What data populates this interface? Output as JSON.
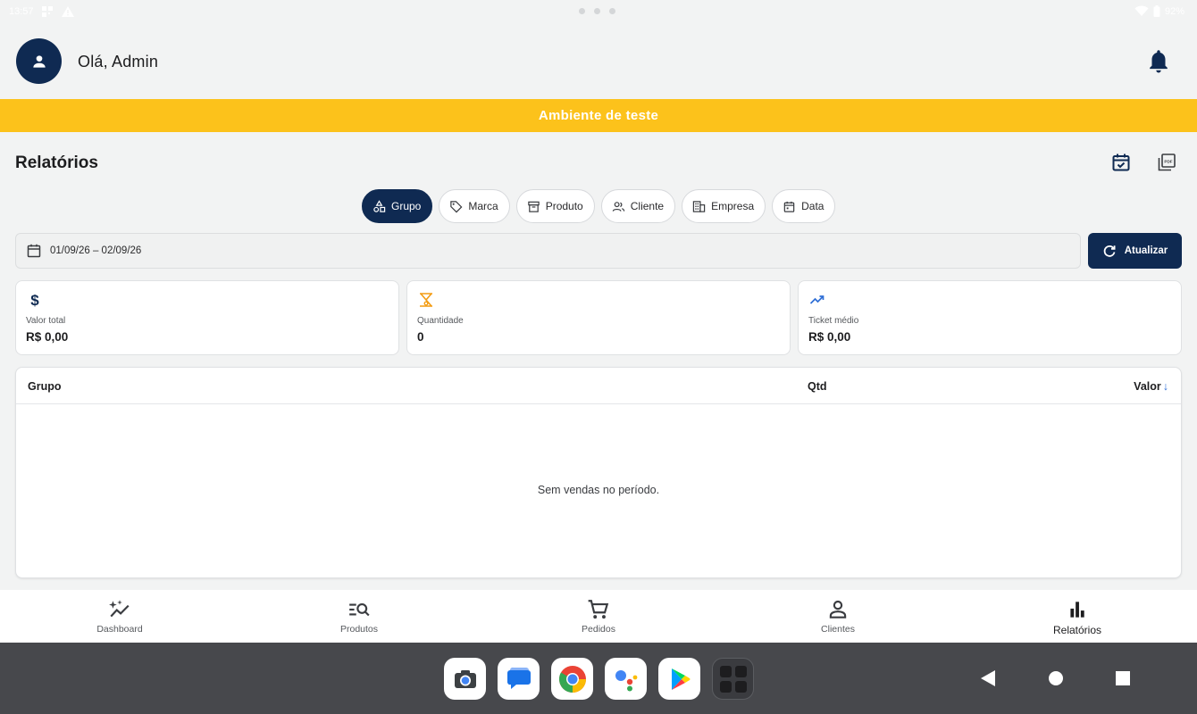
{
  "status_bar": {
    "time": "13:57",
    "battery": "92%"
  },
  "header": {
    "greeting": "Olá, Admin"
  },
  "banner": {
    "text": "Ambiente de teste"
  },
  "page": {
    "title": "Relatórios"
  },
  "filters": [
    {
      "label": "Grupo",
      "icon": "shapes-icon",
      "active": true
    },
    {
      "label": "Marca",
      "icon": "tag-icon",
      "active": false
    },
    {
      "label": "Produto",
      "icon": "box-icon",
      "active": false
    },
    {
      "label": "Cliente",
      "icon": "people-icon",
      "active": false
    },
    {
      "label": "Empresa",
      "icon": "building-icon",
      "active": false
    },
    {
      "label": "Data",
      "icon": "calendar-icon",
      "active": false
    }
  ],
  "date_range": {
    "value": "01/09/26 – 02/09/26"
  },
  "refresh_button": {
    "label": "Atualizar"
  },
  "stats": [
    {
      "label": "Valor total",
      "value": "R$ 0,00",
      "icon": "dollar-icon",
      "color": "#0f2a52"
    },
    {
      "label": "Quantidade",
      "value": "0",
      "icon": "quantity-icon",
      "color": "#f39c12"
    },
    {
      "label": "Ticket médio",
      "value": "R$ 0,00",
      "icon": "trending-up-icon",
      "color": "#2f6fd6"
    }
  ],
  "table": {
    "columns": [
      "Grupo",
      "Qtd",
      "Valor"
    ],
    "sort_indicator": "↓",
    "empty_message": "Sem vendas no período."
  },
  "bottom_nav": [
    {
      "label": "Dashboard",
      "icon": "sparkle-chart-icon",
      "active": false
    },
    {
      "label": "Produtos",
      "icon": "list-search-icon",
      "active": false
    },
    {
      "label": "Pedidos",
      "icon": "cart-icon",
      "active": false
    },
    {
      "label": "Clientes",
      "icon": "person-icon",
      "active": false
    },
    {
      "label": "Relatórios",
      "icon": "bar-chart-icon",
      "active": true
    }
  ],
  "colors": {
    "primary": "#0f2a52",
    "banner": "#fcc21b",
    "background": "#f2f3f3"
  }
}
